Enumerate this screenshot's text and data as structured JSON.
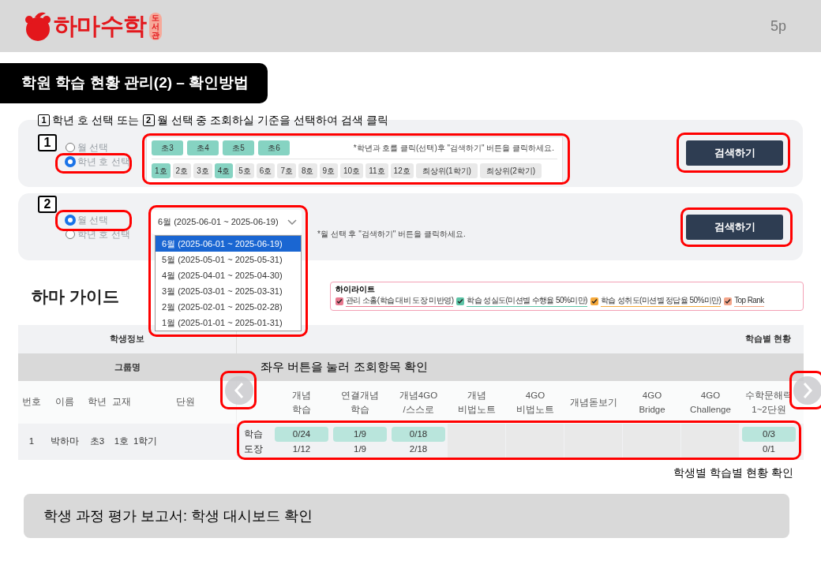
{
  "header": {
    "logo_text": "하마수학",
    "logo_badge": "도서관",
    "page": "5p"
  },
  "title": "학원 학습 현황 관리(2) – 확인방법",
  "instruction": [
    {
      "kind": "badge",
      "text": "1"
    },
    {
      "kind": "text",
      "text": "학년 호 선택 또는"
    },
    {
      "kind": "badge",
      "text": "2"
    },
    {
      "kind": "text",
      "text": "월 선택 중 조회하실 기준을 선택하여 검색 클릭"
    }
  ],
  "panels": [
    {
      "kind": "grade",
      "step": "1",
      "radios": [
        {
          "label": "월 선택",
          "selected": false
        },
        {
          "label": "학년 호 선택",
          "selected": true
        }
      ],
      "grades": [
        {
          "label": "초3",
          "selected": true
        },
        {
          "label": "초4",
          "selected": true
        },
        {
          "label": "초5",
          "selected": true
        },
        {
          "label": "초6",
          "selected": true
        }
      ],
      "note": "*학년과 호를 클릭(선택)후 \"검색하기\" 버튼을 클릭하세요.",
      "classes": [
        {
          "label": "1호",
          "selected": true
        },
        {
          "label": "2호",
          "selected": false
        },
        {
          "label": "3호",
          "selected": false
        },
        {
          "label": "4호",
          "selected": true
        },
        {
          "label": "5호",
          "selected": false
        },
        {
          "label": "6호",
          "selected": false
        },
        {
          "label": "7호",
          "selected": false
        },
        {
          "label": "8호",
          "selected": false
        },
        {
          "label": "9호",
          "selected": false
        },
        {
          "label": "10호",
          "selected": false
        },
        {
          "label": "11호",
          "selected": false
        },
        {
          "label": "12호",
          "selected": false
        },
        {
          "label": "최상위(1학기)",
          "selected": false
        },
        {
          "label": "최상위(2학기)",
          "selected": false
        }
      ],
      "search_button": "검색하기"
    },
    {
      "kind": "month",
      "step": "2",
      "radios": [
        {
          "label": "월 선택",
          "selected": true
        },
        {
          "label": "학년 호 선택",
          "selected": false
        }
      ],
      "select": {
        "value": "6월 (2025-06-01 ~ 2025-06-19)",
        "options": [
          {
            "label": "6월 (2025-06-01 ~ 2025-06-19)",
            "selected": true
          },
          {
            "label": "5월 (2025-05-01 ~ 2025-05-31)",
            "selected": false
          },
          {
            "label": "4월 (2025-04-01 ~ 2025-04-30)",
            "selected": false
          },
          {
            "label": "3월 (2025-03-01 ~ 2025-03-31)",
            "selected": false
          },
          {
            "label": "2월 (2025-02-01 ~ 2025-02-28)",
            "selected": false
          },
          {
            "label": "1월 (2025-01-01 ~ 2025-01-31)",
            "selected": false
          }
        ]
      },
      "note": "*월 선택 후 \"검색하기\" 버튼을 클릭하세요.",
      "search_button": "검색하기"
    }
  ],
  "guide_title": "하마 가이드",
  "legend": {
    "title": "하이라이트",
    "items": [
      {
        "label": "관리 소홀(학습 대비 도장 미반영)",
        "checked": true,
        "color": "#e8798f"
      },
      {
        "label": "학습 성실도(미션별 수행율 50%미만)",
        "checked": true,
        "color": "#5cc4a6"
      },
      {
        "label": "학습 성취도(미션별 정답율 50%미만)",
        "checked": true,
        "color": "#f5a93c"
      },
      {
        "label": "Top Rank",
        "checked": true,
        "color": "#f4a58a"
      }
    ]
  },
  "table": {
    "group_headers": [
      "학생정보",
      "학습별 현황"
    ],
    "group_row": "그룹명",
    "student_columns": [
      "번호",
      "이름",
      "학년",
      "교재",
      "단원"
    ],
    "study_columns": [
      [
        "개념",
        "학습"
      ],
      [
        "연결개념",
        "학습"
      ],
      [
        "개념4GO",
        "/스스로"
      ],
      [
        "개념",
        "비법노트"
      ],
      [
        "4GO",
        "비법노트"
      ],
      [
        "개념돋보기"
      ],
      [
        "4GO",
        "Bridge"
      ],
      [
        "4GO",
        "Challenge"
      ],
      [
        "수학문해력",
        "1~2단원"
      ]
    ],
    "rows": [
      {
        "student": [
          "1",
          "박하마",
          "초3",
          "1호",
          "1학기"
        ],
        "row_labels": [
          "학습",
          "도장"
        ],
        "cells": [
          {
            "kind": "value",
            "study": "0/24",
            "stamp": "1/12"
          },
          {
            "kind": "value",
            "study": "1/9",
            "stamp": "1/9"
          },
          {
            "kind": "value",
            "study": "0/18",
            "stamp": "2/18"
          },
          {
            "kind": "empty"
          },
          {
            "kind": "empty"
          },
          {
            "kind": "empty"
          },
          {
            "kind": "empty"
          },
          {
            "kind": "empty"
          },
          {
            "kind": "value",
            "study": "0/3",
            "stamp": "0/1"
          }
        ]
      }
    ]
  },
  "annotations": {
    "nav": "좌우 버튼을 눌러 조회항목 확인",
    "table": "학생별 학습별 현황 확인"
  },
  "footer_note": "학생 과정 평가 보고서: 학생 대시보드 확인"
}
